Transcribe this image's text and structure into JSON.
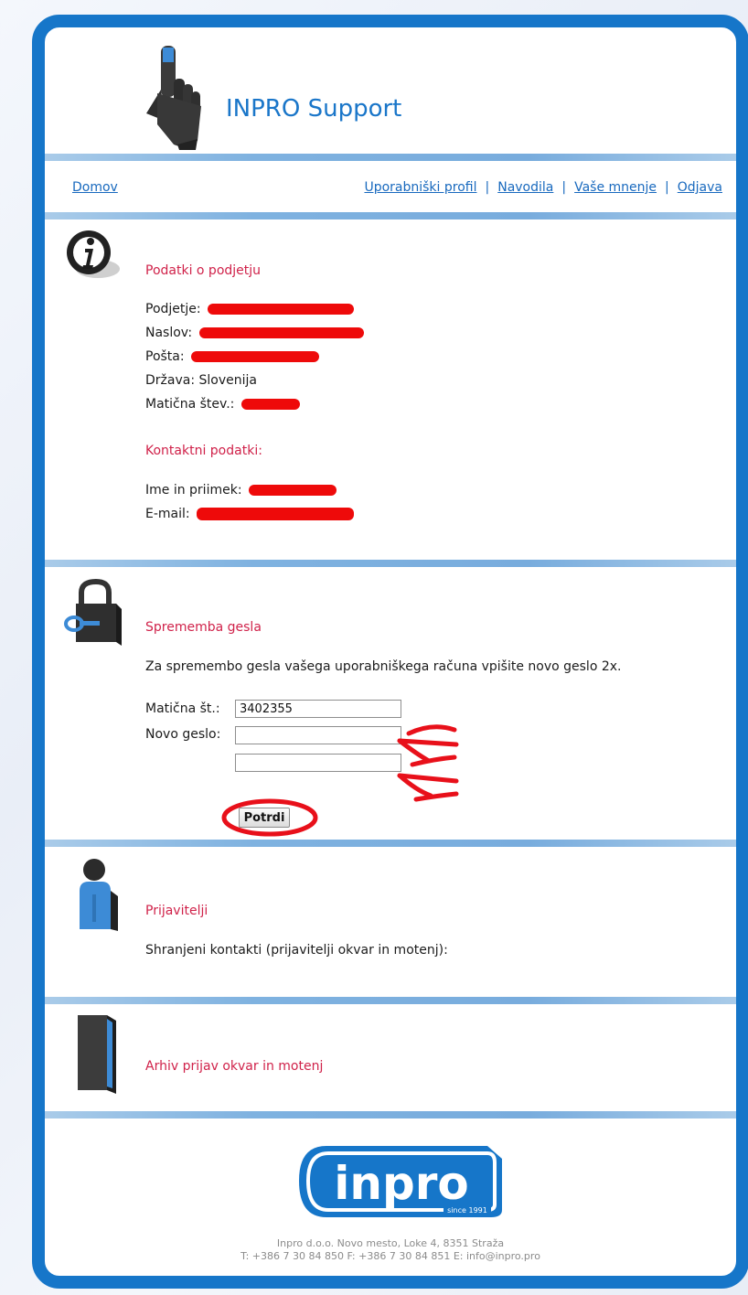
{
  "app": {
    "title": "INPRO Support"
  },
  "nav": {
    "home": "Domov",
    "links": [
      "Uporabniški profil",
      "Navodila",
      "Vaše mnenje",
      "Odjava"
    ],
    "separator": "|"
  },
  "company": {
    "section_title": "Podatki o podjetju",
    "fields": [
      {
        "label": "Podjetje:"
      },
      {
        "label": "Naslov:"
      },
      {
        "label": "Pošta:"
      },
      {
        "label": "Država:",
        "value": "Slovenija"
      },
      {
        "label": "Matična štev.:"
      }
    ],
    "contact_title": "Kontaktni podatki:",
    "contact_fields": [
      {
        "label": "Ime in priimek:"
      },
      {
        "label": "E-mail:"
      }
    ]
  },
  "password": {
    "section_title": "Sprememba gesla",
    "instructions": "Za spremembo gesla vašega uporabniškega računa vpišite novo geslo 2x.",
    "id_label": "Matična št.:",
    "id_value": "3402355",
    "new_label": "Novo geslo:",
    "new_value": "",
    "confirm_value": "",
    "submit_label": "Potrdi"
  },
  "reporters": {
    "section_title": "Prijavitelji",
    "text": "Shranjeni kontakti (prijavitelji okvar in motenj):"
  },
  "archive": {
    "section_title": "Arhiv prijav okvar in motenj"
  },
  "footer": {
    "logo_text": "inpro",
    "logo_since": "since 1991",
    "address": "Inpro d.o.o. Novo mesto, Loke 4, 8351 Straža",
    "contacts": "T: +386 7 30 84 850   F: +386 7 30 84 851   E: info@inpro.pro"
  },
  "colors": {
    "frame": "#1676c9",
    "title": "#1a76c9",
    "section_heading": "#d0224a",
    "link": "#1869be",
    "redaction": "#ee0a0a",
    "annotation": "#e8101a"
  },
  "icons": [
    "pointing-hand-icon",
    "info-icon",
    "padlock-icon",
    "user-icon",
    "binder-icon"
  ]
}
